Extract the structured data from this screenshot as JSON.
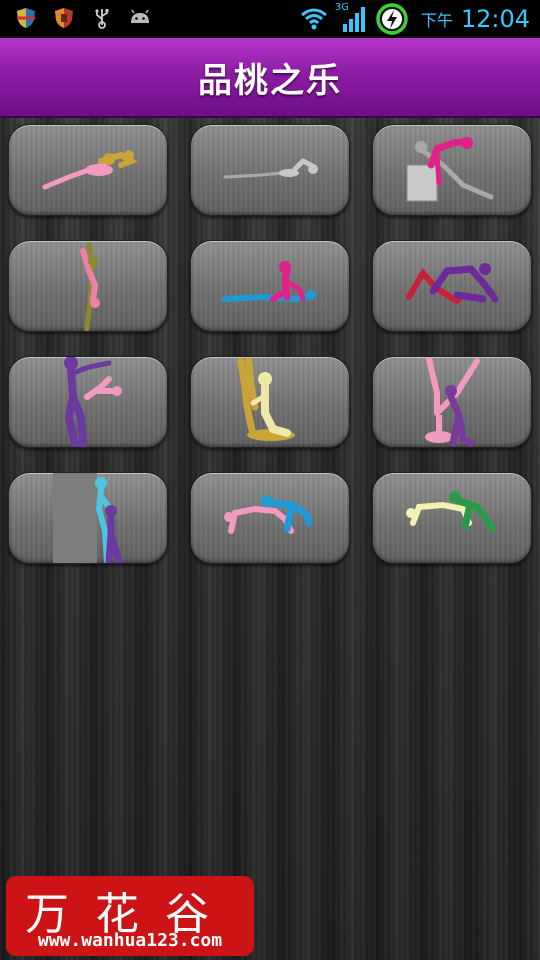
{
  "status_bar": {
    "notification_icons": [
      "shield-icon",
      "shield-alt-icon",
      "usb-icon",
      "android-icon"
    ],
    "network_label": "3G",
    "ampm": "下午",
    "time": "12:04"
  },
  "header": {
    "title": "品桃之乐"
  },
  "tiles": [
    {
      "name": "pose-tile-1",
      "colors": [
        "#f29ac0",
        "#c9a437"
      ]
    },
    {
      "name": "pose-tile-2",
      "colors": [
        "#c7c7c7",
        "#a9a9a9"
      ]
    },
    {
      "name": "pose-tile-3",
      "colors": [
        "#e0218a",
        "#a8a8a8"
      ]
    },
    {
      "name": "pose-tile-4",
      "colors": [
        "#f07fa8",
        "#8a8a2e"
      ]
    },
    {
      "name": "pose-tile-5",
      "colors": [
        "#e0218a",
        "#1e9ad6"
      ]
    },
    {
      "name": "pose-tile-6",
      "colors": [
        "#6c2a9a",
        "#c9203a"
      ]
    },
    {
      "name": "pose-tile-7",
      "colors": [
        "#6a3aa0",
        "#f29ac0"
      ]
    },
    {
      "name": "pose-tile-8",
      "colors": [
        "#f0e8a8",
        "#c9a437"
      ]
    },
    {
      "name": "pose-tile-9",
      "colors": [
        "#f29ac0",
        "#7a3a9a"
      ]
    },
    {
      "name": "pose-tile-10",
      "colors": [
        "#4fc3e0",
        "#6a3aa0"
      ]
    },
    {
      "name": "pose-tile-11",
      "colors": [
        "#f29ac0",
        "#1e9ad6"
      ]
    },
    {
      "name": "pose-tile-12",
      "colors": [
        "#f3f1b0",
        "#2a9a4a"
      ]
    }
  ],
  "watermark": {
    "chinese": "万花谷",
    "url": "www.wanhua123.com"
  },
  "colors": {
    "accent": "#8d1ca5",
    "clock": "#39c7ff",
    "watermark_bg": "#cc1416"
  }
}
